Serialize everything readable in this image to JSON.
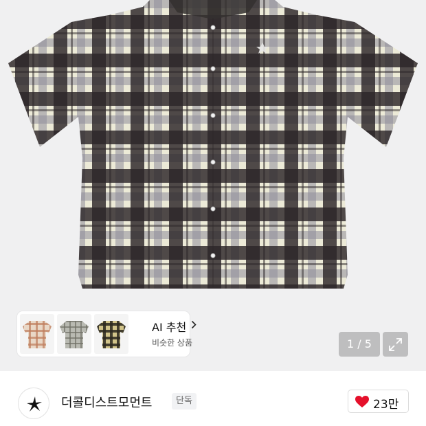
{
  "product": {
    "image_alt": "plaid short-sleeve shirt",
    "pattern_colors": [
      "#2c2628",
      "#ecead7",
      "#8f8c9a"
    ]
  },
  "ai_recommend": {
    "title": "AI 추천",
    "subtitle": "비슷한 상품",
    "thumb_colors": [
      "#c9a58c",
      "#8f9186",
      "#56523a"
    ]
  },
  "gallery": {
    "counter": "1 / 5"
  },
  "brand": {
    "name": "더콜디스트모먼트",
    "badge": "단독",
    "likes": "23만",
    "like_color": "#e5102b"
  }
}
